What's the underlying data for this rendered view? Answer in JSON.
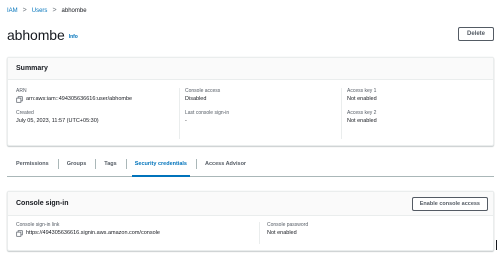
{
  "breadcrumb": {
    "items": [
      "IAM",
      "Users"
    ],
    "current": "abhombe",
    "separator": ">"
  },
  "header": {
    "title": "abhombe",
    "info_link": "Info",
    "delete_label": "Delete"
  },
  "summary": {
    "title": "Summary",
    "arn_label": "ARN",
    "arn_value": "arn:aws:iam::494305636616:user/abhombe",
    "created_label": "Created",
    "created_value": "July 05, 2023, 11:57 (UTC+05:30)",
    "console_access_label": "Console access",
    "console_access_value": "Disabled",
    "last_signin_label": "Last console sign-in",
    "last_signin_value": "-",
    "access_key1_label": "Access key 1",
    "access_key1_value": "Not enabled",
    "access_key2_label": "Access key 2",
    "access_key2_value": "Not enabled"
  },
  "tabs": [
    {
      "label": "Permissions",
      "active": false
    },
    {
      "label": "Groups",
      "active": false
    },
    {
      "label": "Tags",
      "active": false
    },
    {
      "label": "Security credentials",
      "active": true
    },
    {
      "label": "Access Advisor",
      "active": false
    }
  ],
  "console_signin": {
    "title": "Console sign-in",
    "enable_label": "Enable console access",
    "link_label": "Console sign-in link",
    "link_value": "https://494305636616.signin.aws.amazon.com/console",
    "password_label": "Console password",
    "password_value": "Not enabled"
  },
  "colors": {
    "link": "#0073bb",
    "text": "#16191f",
    "muted": "#545b64",
    "border": "#eaeded"
  },
  "icons": {
    "copy": "copy-icon",
    "chevron": "chevron-right-icon"
  }
}
